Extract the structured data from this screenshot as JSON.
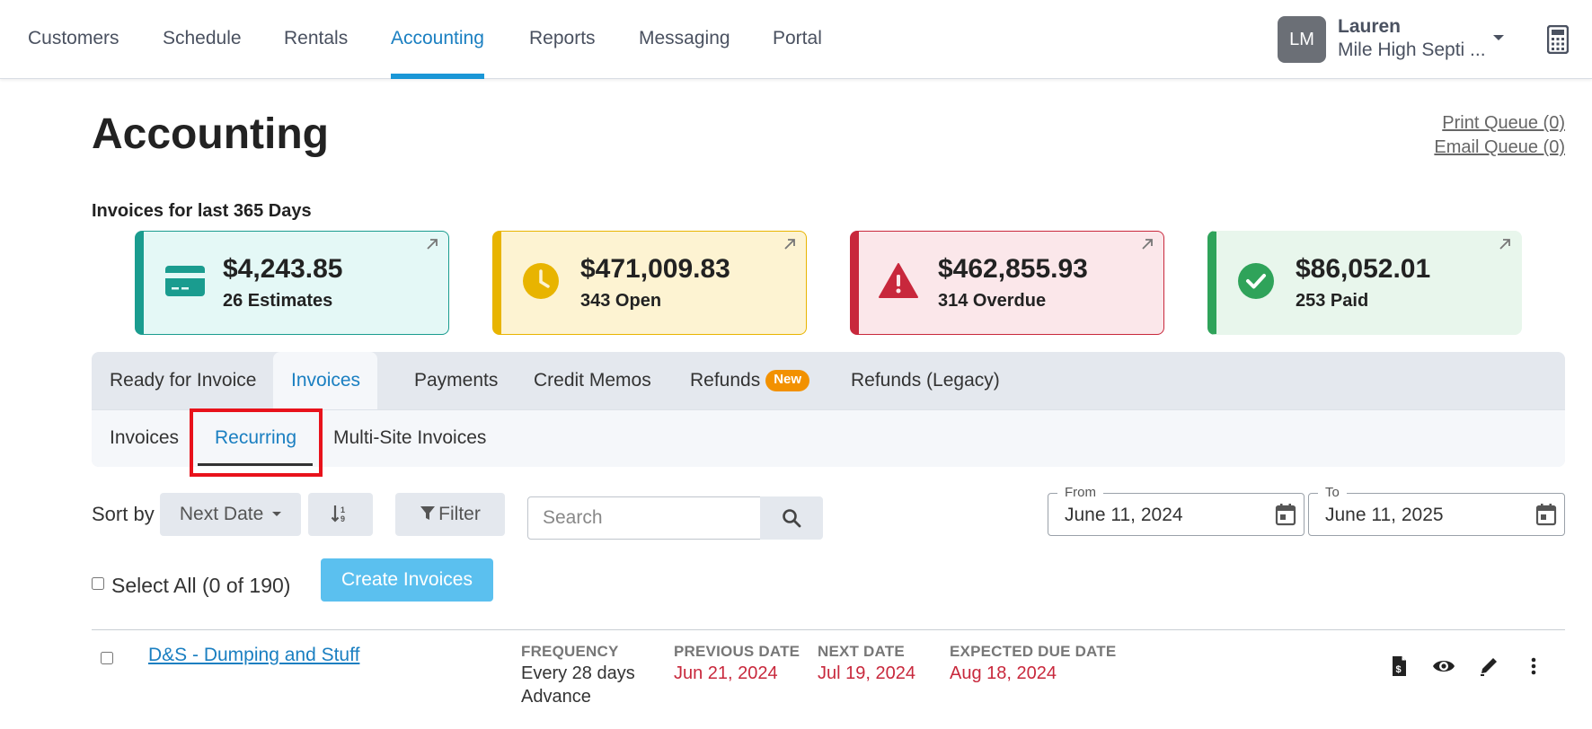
{
  "nav": {
    "items": [
      "Customers",
      "Schedule",
      "Rentals",
      "Accounting",
      "Reports",
      "Messaging",
      "Portal"
    ],
    "active": "Accounting"
  },
  "user": {
    "initials": "LM",
    "name": "Lauren",
    "company": "Mile High Septi ..."
  },
  "page": {
    "title": "Accounting",
    "print_queue": "Print Queue (0)",
    "email_queue": "Email Queue (0)",
    "summary_label": "Invoices for last 365 Days"
  },
  "cards": [
    {
      "amount": "$4,243.85",
      "count": "26 Estimates",
      "icon": "credit-card-icon",
      "color": "#1a9c8f",
      "bg": "#e4f8f6"
    },
    {
      "amount": "$471,009.83",
      "count": "343 Open",
      "icon": "clock-icon",
      "color": "#e8b400",
      "bg": "#fdf3d2"
    },
    {
      "amount": "$462,855.93",
      "count": "314 Overdue",
      "icon": "warning-icon",
      "color": "#c8283c",
      "bg": "#fbe7ea"
    },
    {
      "amount": "$86,052.01",
      "count": "253 Paid",
      "icon": "check-circle-icon",
      "color": "#2fa35a",
      "bg": "#e8f6ec"
    }
  ],
  "tabs": {
    "items": [
      "Ready for Invoice",
      "Invoices",
      "Payments",
      "Credit Memos",
      "Refunds",
      "Refunds (Legacy)"
    ],
    "new_badge": "New",
    "active": "Invoices"
  },
  "subtabs": {
    "items": [
      "Invoices",
      "Recurring",
      "Multi-Site Invoices"
    ],
    "active": "Recurring"
  },
  "toolbar": {
    "sort_label": "Sort by",
    "sort_value": "Next Date",
    "filter_label": "Filter",
    "search_placeholder": "Search",
    "from_label": "From",
    "from_value": "June 11, 2024",
    "to_label": "To",
    "to_value": "June 11, 2025",
    "select_all": "Select All (0 of 190)",
    "create_label": "Create Invoices"
  },
  "columns": {
    "frequency": "FREQUENCY",
    "previous": "PREVIOUS DATE",
    "next": "NEXT DATE",
    "due": "EXPECTED DUE DATE"
  },
  "rows": [
    {
      "name": "D&S - Dumping and Stuff",
      "frequency": "Every 28 days",
      "frequency_mode": "Advance",
      "previous": "Jun 21, 2024",
      "next": "Jul 19, 2024",
      "due": "Aug 18, 2024"
    }
  ]
}
